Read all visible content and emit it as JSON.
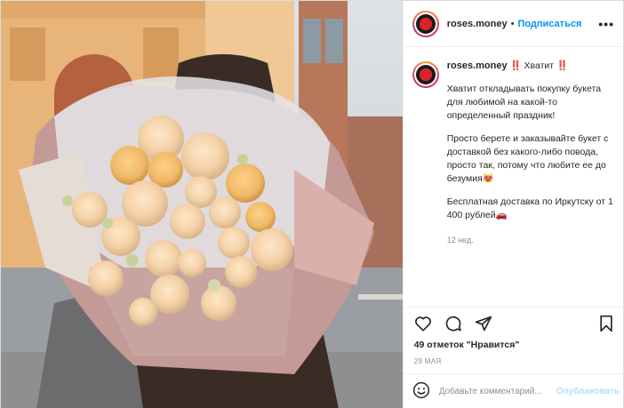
{
  "header": {
    "username": "roses.money",
    "separator": "•",
    "follow_label": "Подписаться",
    "more_label": "•••"
  },
  "caption": {
    "username": "roses.money",
    "headline": "‼️ Хватит ‼️",
    "paragraph1": "Хватит откладывать покупку букета для любимой на какой-то определенный праздник!",
    "paragraph2": "Просто берете и заказывайте букет с доставкой без какого-либо повода, просто так, потому что любите ее до безумия😻",
    "paragraph3": "Бесплатная доставка по Иркутску от 1 400 рублей🚗",
    "time_ago": "12 нед."
  },
  "stats": {
    "likes": "49 отметок \"Нравится\"",
    "date": "29 МАЯ"
  },
  "comment": {
    "placeholder": "Добавьте комментарий...",
    "publish_label": "Опубликовать"
  },
  "colors": {
    "accent": "#0095f6",
    "publish_disabled": "#b2dffc",
    "text": "#262626",
    "muted": "#8e8e8e"
  },
  "icons": [
    "more-icon",
    "heart-icon",
    "comment-icon",
    "share-icon",
    "bookmark-icon",
    "emoji-icon"
  ]
}
